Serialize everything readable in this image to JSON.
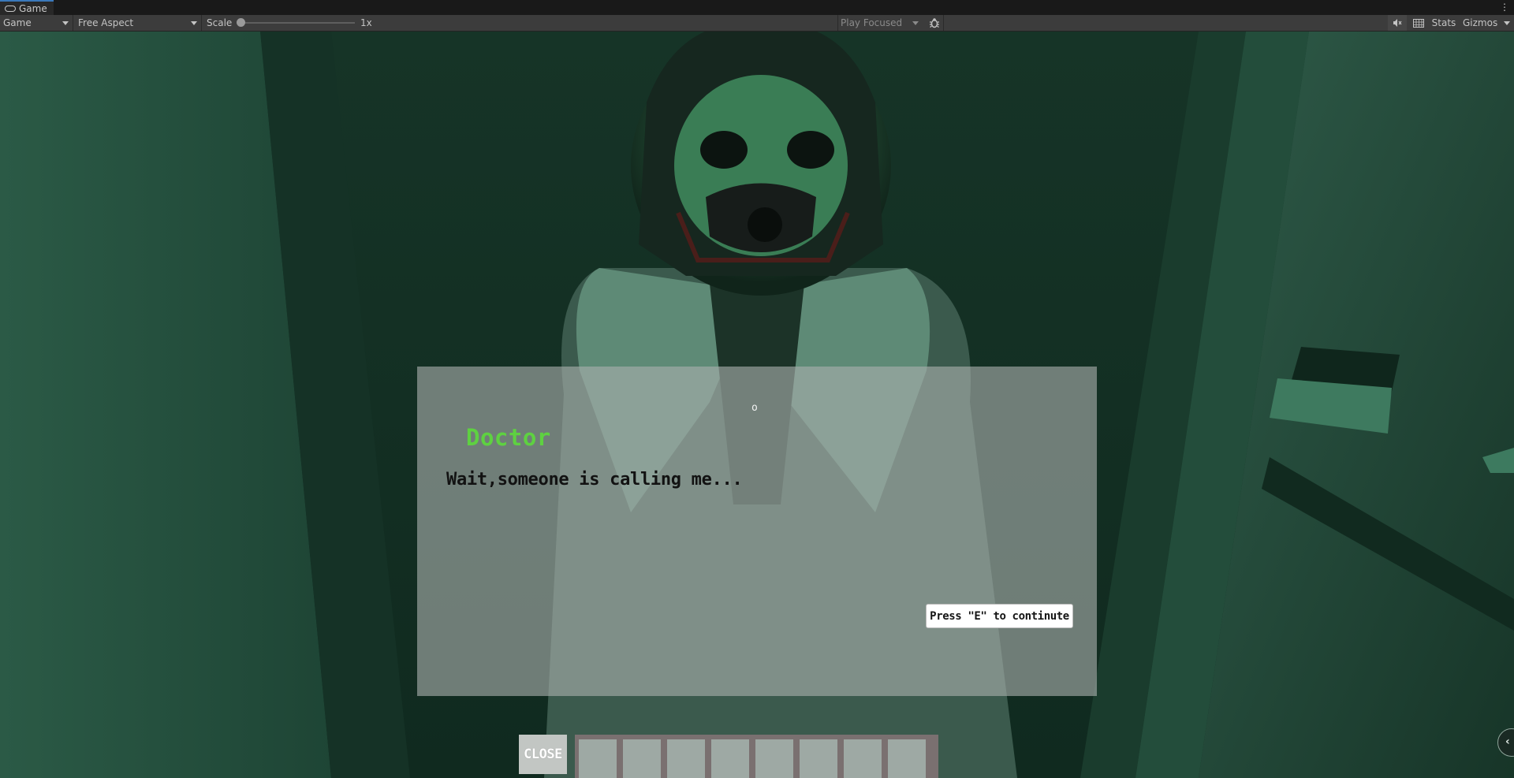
{
  "window": {
    "tab_title": "Game",
    "menu_icon": "kebab-menu-icon"
  },
  "toolbar": {
    "display_dropdown": "Game",
    "aspect_dropdown": "Free Aspect",
    "scale_label": "Scale",
    "scale_value": "1x",
    "scale_slider_level": 0,
    "play_mode_dropdown": "Play Focused",
    "debug_icon": "bug-icon",
    "mute_icon": "mute-audio-icon",
    "grid_icon": "keyboard-grid-icon",
    "stats_label": "Stats",
    "gizmos_label": "Gizmos"
  },
  "game": {
    "crosshair": "o",
    "dialogue": {
      "speaker": "Doctor",
      "text": "Wait,someone is calling me...",
      "continue_prompt": "Press \"E\" to continute"
    },
    "close_button": "CLOSE",
    "inventory_slots": 8,
    "side_button_icon": "chevron-left-icon"
  },
  "colors": {
    "speaker_name": "#5ed141",
    "scene_tint": "#1b3a2e",
    "toolbar_bg": "#3c3c3c"
  }
}
